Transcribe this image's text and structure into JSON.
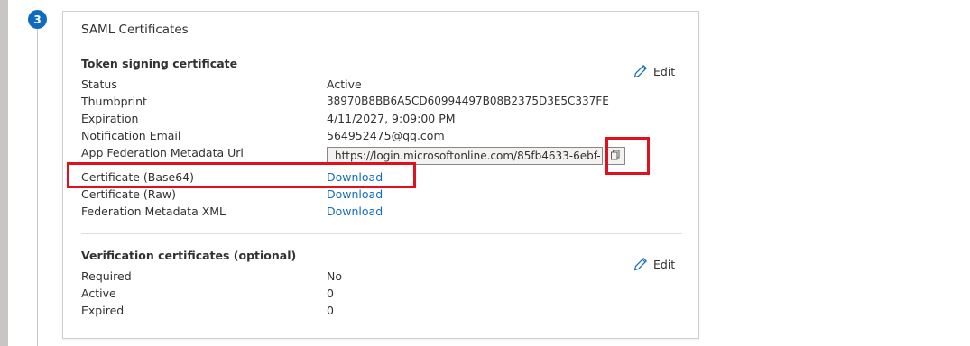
{
  "step": {
    "number": "3"
  },
  "card": {
    "title": "SAML Certificates",
    "token_signing": {
      "title": "Token signing certificate",
      "edit_label": "Edit",
      "rows": [
        {
          "label": "Status",
          "value": "Active"
        },
        {
          "label": "Thumbprint",
          "value": "38970B8BB6A5CD60994497B08B2375D3E5C337FE"
        },
        {
          "label": "Expiration",
          "value": "4/11/2027, 9:09:00 PM"
        },
        {
          "label": "Notification Email",
          "value": "564952475@qq.com"
        },
        {
          "label": "App Federation Metadata Url",
          "value": "https://login.microsoftonline.com/85fb4633-6ebf-..."
        },
        {
          "label": "Certificate (Base64)",
          "value": "Download"
        },
        {
          "label": "Certificate (Raw)",
          "value": "Download"
        },
        {
          "label": "Federation Metadata XML",
          "value": "Download"
        }
      ]
    },
    "verification": {
      "title": "Verification certificates (optional)",
      "edit_label": "Edit",
      "rows": [
        {
          "label": "Required",
          "value": "No"
        },
        {
          "label": "Active",
          "value": "0"
        },
        {
          "label": "Expired",
          "value": "0"
        }
      ]
    }
  },
  "icons": {
    "edit": "pencil-icon",
    "copy": "copy-icon"
  },
  "colors": {
    "accent": "#0f6cbd",
    "highlight": "#e0101e",
    "rail": "#c8c6c4"
  }
}
